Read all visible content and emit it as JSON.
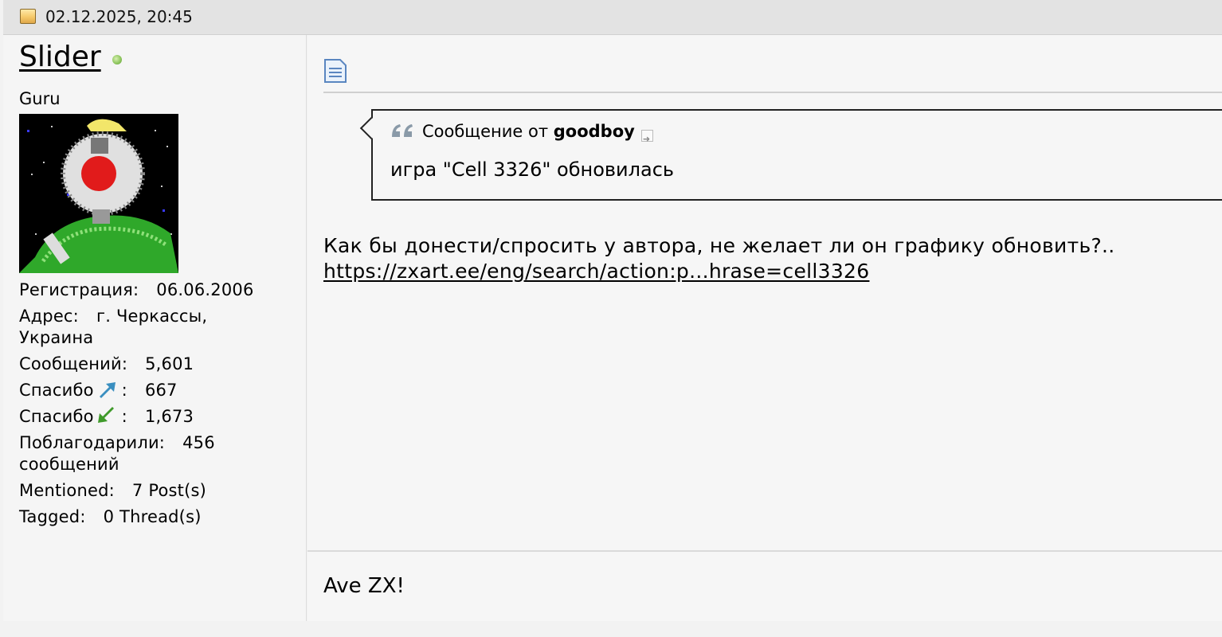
{
  "post": {
    "date": "02.12.2025, 20:45"
  },
  "user": {
    "name": "Slider",
    "title": "Guru",
    "info": [
      {
        "label": "Регистрация:",
        "value": "06.06.2006"
      },
      {
        "label": "Адрес:",
        "value": "г. Черкассы, Украина"
      },
      {
        "label": "Сообщений:",
        "value": "5,601"
      },
      {
        "label": "Спасибо",
        "suffix": ":",
        "value": "667",
        "icon": "thanks-given-arrow-icon"
      },
      {
        "label": "Спасибо",
        "suffix": ":",
        "value": "1,673",
        "icon": "thanks-received-arrow-icon"
      },
      {
        "label": "Поблагодарили:",
        "value": "456 сообщений"
      },
      {
        "label": "Mentioned:",
        "value": "7 Post(s)"
      },
      {
        "label": "Tagged:",
        "value": "0 Thread(s)"
      }
    ]
  },
  "quote": {
    "prefix": "Сообщение от",
    "author": "goodboy",
    "text": "игра \"Cell 3326\" обновилась"
  },
  "message": {
    "text": "Как бы донести/спросить у автора, не желает ли он графику обновить?..",
    "link": "https://zxart.ee/eng/search/action:p...hrase=cell3326"
  },
  "signature": "Ave ZX!",
  "colors": {
    "thanks_up": "#3a8fc0",
    "thanks_down": "#3f9a2a",
    "online": "#8ac35a"
  }
}
